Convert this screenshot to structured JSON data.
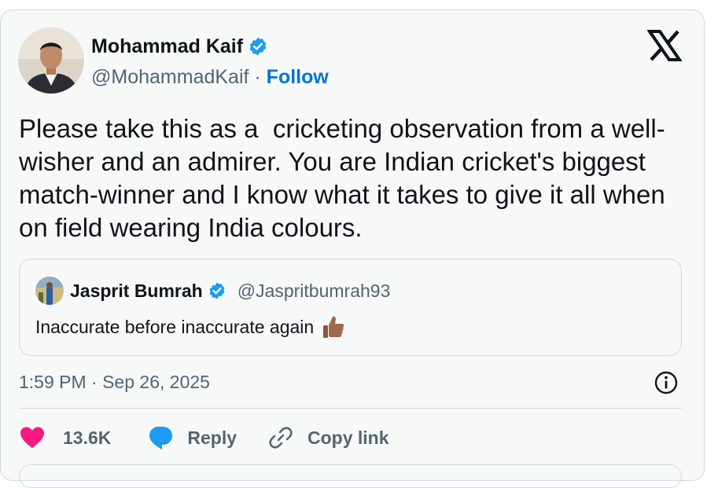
{
  "author": {
    "name": "Mohammad Kaif",
    "handle": "@MohammadKaif",
    "separator": " · ",
    "follow_label": "Follow",
    "avatar_icon": "profile-photo",
    "verified_color": "#1d9bf0"
  },
  "platform_icon": "x-logo-icon",
  "tweet": {
    "text": "Please take this as a  cricketing observation from a well-wisher and an admirer. You are Indian cricket's biggest match-winner and I know what it takes to give it all when on field wearing India colours."
  },
  "quoted_tweet": {
    "name": "Jasprit Bumrah",
    "handle": "@Jaspritbumrah93",
    "text": "Inaccurate before inaccurate again",
    "emoji_icon": "thumbs-up-icon"
  },
  "meta": {
    "timestamp": "1:59 PM · Sep 26, 2025"
  },
  "actions": {
    "likes_count": "13.6K",
    "reply_label": "Reply",
    "copy_link_label": "Copy link"
  },
  "colors": {
    "like": "#f91880",
    "reply": "#1d9bf0",
    "link": "#0074d4",
    "muted": "#536471",
    "text": "#0f1419"
  }
}
